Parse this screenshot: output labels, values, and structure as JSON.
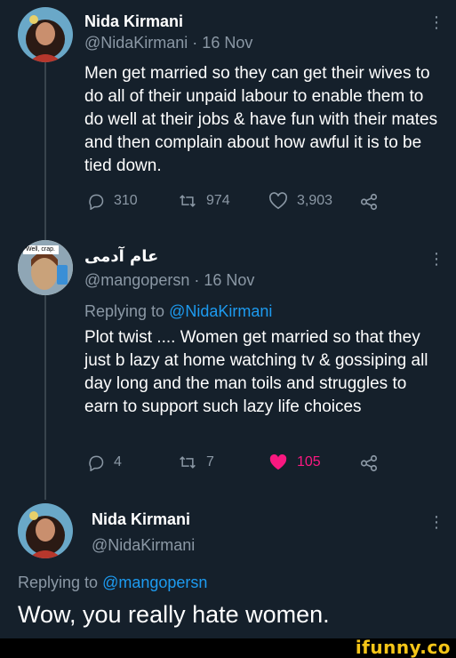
{
  "tweet1": {
    "name": "Nida Kirmani",
    "handle_date": "@NidaKirmani · 16 Nov",
    "text": "Men get married so they can get their wives to do all of their unpaid labour to enable them to do well at their jobs & have fun with their mates and then complain about how awful it is to be tied down.",
    "replies": "310",
    "retweets": "974",
    "likes": "3,903"
  },
  "tweet2": {
    "name": "عام آدمی",
    "avatar_caption": "Well, crap.",
    "handle_date": "@mangopersn · 16 Nov",
    "replying_prefix": "Replying to",
    "replying_handle": "@NidaKirmani",
    "text": "Plot twist .... Women get married so that they just b lazy at home watching tv & gossiping all day long and the man toils and struggles to earn to support such lazy life choices",
    "replies": "4",
    "retweets": "7",
    "likes": "105",
    "liked_color": "#f91880"
  },
  "tweet3": {
    "name": "Nida Kirmani",
    "handle": "@NidaKirmani",
    "replying_prefix": "Replying to",
    "replying_handle": "@mangopersn",
    "text": "Wow, you really hate women."
  },
  "watermark": "ifunny.co",
  "icons": {
    "reply": "reply-icon",
    "retweet": "retweet-icon",
    "like": "heart-icon",
    "share": "share-icon",
    "more": "more-icon"
  }
}
